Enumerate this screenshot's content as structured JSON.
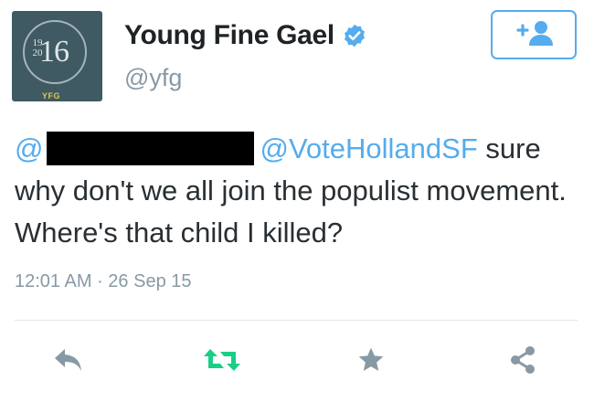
{
  "user": {
    "display_name": "Young Fine Gael",
    "handle": "@yfg",
    "avatar": {
      "year_main": "16",
      "year_small_top": "19",
      "year_small_bottom": "20",
      "badge": "YFG"
    },
    "verified": true
  },
  "follow_button": {
    "icon": "add-user-icon",
    "color": "#55acee"
  },
  "tweet": {
    "mention_start": "@",
    "redacted": true,
    "mention_2": "@VoteHollandSF",
    "text_line1_tail": " sure",
    "text_rest": "why don't we all join the populist movement. Where's that child I killed?"
  },
  "meta": {
    "time": "12:01 AM",
    "separator": " · ",
    "date": "26 Sep 15"
  },
  "actions": [
    {
      "name": "reply",
      "icon": "reply-icon",
      "color": "#8899a6"
    },
    {
      "name": "retweet",
      "icon": "retweet-icon",
      "color": "#19cf86"
    },
    {
      "name": "favorite",
      "icon": "star-icon",
      "color": "#8899a6"
    },
    {
      "name": "share",
      "icon": "share-icon",
      "color": "#8899a6"
    }
  ],
  "colors": {
    "link": "#55acee",
    "muted": "#8899a6",
    "text": "#292f33",
    "retweeted": "#19cf86"
  }
}
